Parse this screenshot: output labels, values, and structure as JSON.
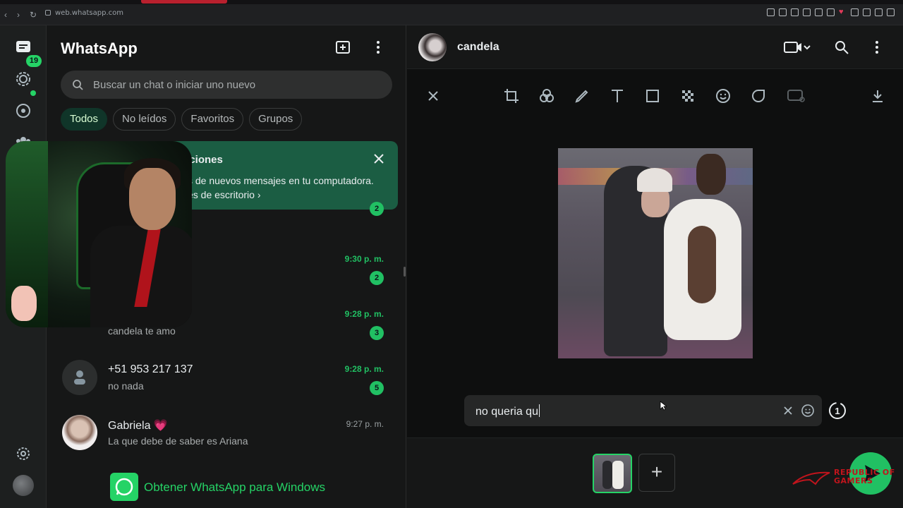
{
  "browser": {
    "url": "web.whatsapp.com",
    "nav_icons": [
      "back-icon",
      "forward-icon",
      "reload-icon",
      "lock-icon"
    ]
  },
  "rail": {
    "chats_badge": "19",
    "icons": [
      "chats-icon",
      "status-icon",
      "channels-icon",
      "communities-icon",
      "settings-icon",
      "profile-avatar"
    ]
  },
  "sidebar": {
    "title": "WhatsApp",
    "search_placeholder": "Buscar un chat o iniciar uno nuevo",
    "filters": [
      "Todos",
      "No leídos",
      "Favoritos",
      "Grupos"
    ],
    "active_filter": "Todos",
    "notification": {
      "title": "aciones",
      "line1": "s de nuevos mensajes en tu computadora.",
      "line2": "es de escritorio"
    },
    "chats": [
      {
        "name": "",
        "message": "",
        "time": "",
        "unread": "2"
      },
      {
        "name": "",
        "message": "",
        "time": "9:30 p. m.",
        "unread": "2"
      },
      {
        "name": "e",
        "message": "candela te amo",
        "time": "9:28 p. m.",
        "unread": "3"
      },
      {
        "name": "+51 953 217 137",
        "message": "no nada",
        "time": "9:28 p. m.",
        "unread": "5"
      },
      {
        "name": "Gabriela 💗",
        "message": "La que debe de saber es Ariana",
        "time": "9:27 p. m.",
        "unread": ""
      }
    ],
    "get_app": "Obtener WhatsApp para Windows"
  },
  "chat": {
    "contact_name": "candela",
    "caption_value": "no queria qu",
    "once_label": "1",
    "editor_tools": [
      "close-icon",
      "crop-icon",
      "filter-icon",
      "pencil-icon",
      "text-icon",
      "rectangle-icon",
      "blur-icon",
      "emoji-icon",
      "sticker-icon",
      "hd-icon",
      "download-icon"
    ]
  },
  "overlay": {
    "brand_line1": "REPUBLIC OF",
    "brand_line2": "GAMERS"
  },
  "colors": {
    "accent": "#25d366",
    "active_chip": "#103529",
    "notification": "#1b5d43"
  }
}
